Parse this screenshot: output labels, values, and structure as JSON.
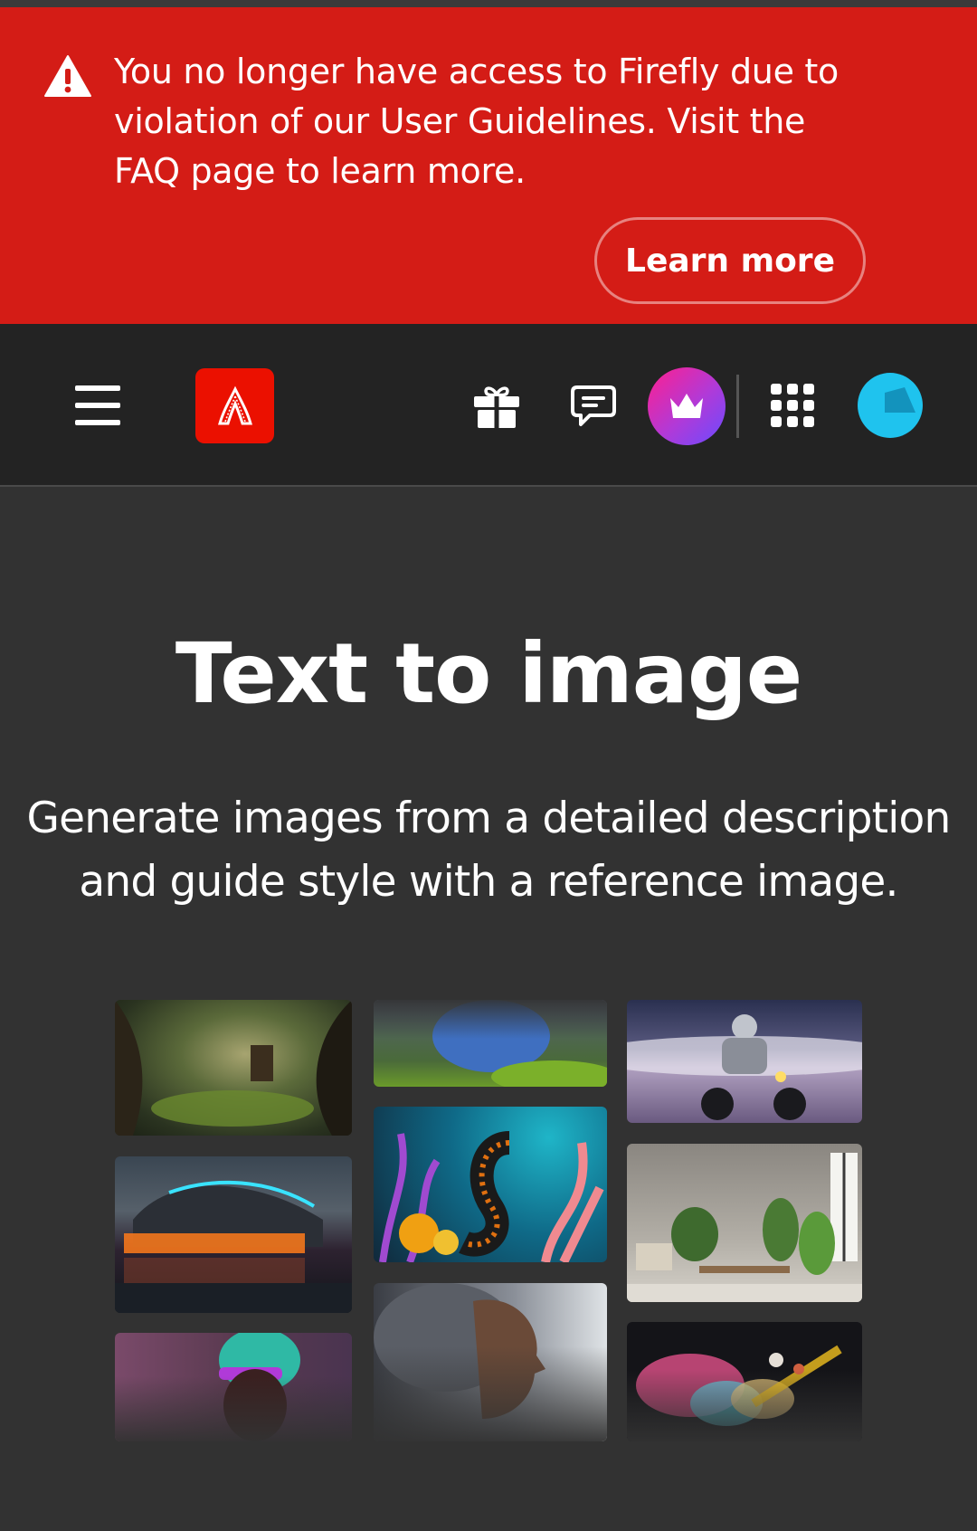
{
  "alert": {
    "message": "You no longer have access to Firefly due to violation of our User Guidelines. Visit the FAQ page to learn more.",
    "button_label": "Learn more",
    "icon": "warning-icon",
    "color": "#d41c16"
  },
  "header": {
    "menu_icon": "hamburger-menu-icon",
    "logo": "adobe-firefly-logo",
    "gift_icon": "gift-icon",
    "feedback_icon": "chat-feedback-icon",
    "premium_icon": "crown-icon",
    "apps_icon": "app-grid-icon",
    "avatar": "user-avatar",
    "premium_gradient": [
      "#ff1f8e",
      "#6a4bff"
    ],
    "avatar_color": "#1fc3ee"
  },
  "main": {
    "title": "Text to image",
    "subtitle": "Generate images from a detailed description and guide style with a reference image."
  },
  "gallery": {
    "items": [
      "fantasy-forest-house",
      "neon-lake-building",
      "neon-portrait-beanie",
      "blue-creature-moss",
      "seahorse-coral",
      "woman-profile-clouds",
      "astronaut-motorcycle",
      "plant-filled-room",
      "color-powder-planets"
    ]
  }
}
